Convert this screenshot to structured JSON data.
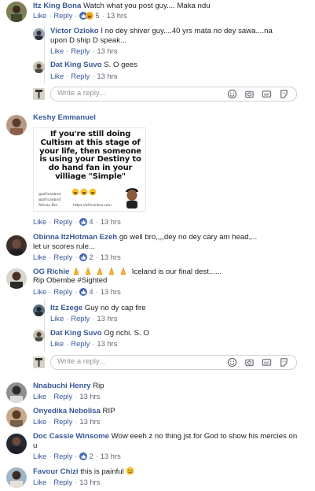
{
  "comment1": {
    "name": "Itz King Bona",
    "text": "Watch what you post guy.... Maka ndu",
    "like": "Like",
    "reply": "Reply",
    "reactions": "5",
    "time": "13 hrs"
  },
  "comment1_replies": [
    {
      "name": "Victor Ozioko",
      "text_line1": "I no dey shiver guy....40 yrs mata no dey sawa....na",
      "text_line2": "upon D ship D speak...",
      "like": "Like",
      "reply": "Reply",
      "time": "13 hrs"
    },
    {
      "name": "Dat King Suvo",
      "text_line1": "S. O gees",
      "like": "Like",
      "reply": "Reply",
      "time": "13 hrs"
    }
  ],
  "reply_box_1": {
    "placeholder": "Write a reply..."
  },
  "comment2": {
    "name": "Keshy Emmanuel",
    "image_text": "If you're still doing Cultism at this stage of your life, then someone is using your Destiny to do hand fan in your villiage \"Simple\"",
    "image_handles": [
      "@africanbrot",
      "@africanbrot",
      "African Bro"
    ],
    "image_url_text": "https://africanbro.com",
    "like": "Like",
    "reply": "Reply",
    "reactions": "4",
    "time": "13 hrs"
  },
  "comment3": {
    "name": "Obinna ItzHotman Ezeh",
    "text_line1": "go well bro,,,,dey no dey cary am head,...",
    "text_line2": "let ur scores rule...",
    "like": "Like",
    "reply": "Reply",
    "reactions": "2",
    "time": "13 hrs"
  },
  "comment4": {
    "name": "OG Richie",
    "text_line1": "Iceland is our final dest......",
    "text_line2": "Rip Obembe #Sighted",
    "like": "Like",
    "reply": "Reply",
    "reactions": "4",
    "time": "13 hrs"
  },
  "comment4_replies": [
    {
      "name": "Itz Ezege",
      "text_line1": "Guy no dy cap fire",
      "like": "Like",
      "reply": "Reply",
      "time": "13 hrs"
    },
    {
      "name": "Dat King Suvo",
      "text_line1": "Og richi. S. O",
      "like": "Like",
      "reply": "Reply",
      "time": "13 hrs"
    }
  ],
  "reply_box_2": {
    "placeholder": "Write a reply..."
  },
  "comment5": {
    "name": "Nnabuchi Henry",
    "text_line1": "Rip",
    "like": "Like",
    "reply": "Reply",
    "time": "13 hrs"
  },
  "comment6": {
    "name": "Onyedika Nebolisa",
    "text_line1": "RIP",
    "like": "Like",
    "reply": "Reply",
    "time": "13 hrs"
  },
  "comment7": {
    "name": "Doc Cassie Winsome",
    "text_line1": "Wow eeeh z no thing jst for God to show his mercies on",
    "text_line2": "u",
    "like": "Like",
    "reply": "Reply",
    "reactions": "2",
    "time": "13 hrs"
  },
  "comment8": {
    "name": "Favour Chizi",
    "text_line1": "this is painful",
    "like": "Like",
    "reply": "Reply",
    "time": "13 hrs"
  },
  "colors": {
    "link": "#385898",
    "meta": "#606770",
    "like_blue": "#4267b2",
    "haha_yellow": "#f7b125",
    "border": "#ccd0d5"
  }
}
